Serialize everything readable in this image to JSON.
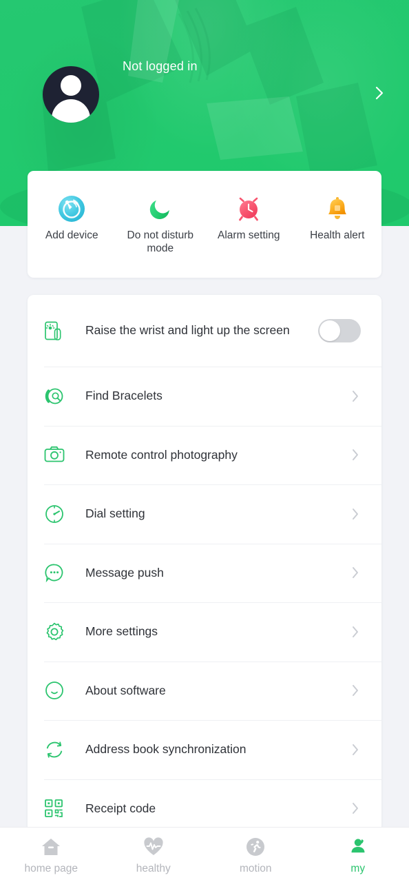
{
  "colors": {
    "brand_green": "#22c96e",
    "accent_green": "#2bc46e",
    "page_bg": "#f2f3f7",
    "card_bg": "#ffffff",
    "text_primary": "#2f3238",
    "text_muted": "#b3b5bb",
    "avatar_bg": "#1e2233",
    "toggle_off": "#d3d5d9",
    "add_device_icon": "#3fc6dd",
    "dnd_icon": "#22c96e",
    "alarm_icon": "#f8556f",
    "health_alert_icon": "#fcb024"
  },
  "header": {
    "login_status": "Not logged in",
    "chevron_icon": "chevron-right-icon",
    "avatar_icon": "default-avatar-icon"
  },
  "quick_actions": [
    {
      "label": "Add device",
      "icon": "add-device-icon"
    },
    {
      "label": "Do not disturb mode",
      "icon": "moon-icon"
    },
    {
      "label": "Alarm setting",
      "icon": "alarm-clock-icon"
    },
    {
      "label": "Health alert",
      "icon": "bell-icon"
    }
  ],
  "settings_rows": [
    {
      "label": "Raise the wrist and light up the screen",
      "icon": "wrist-raise-screen-icon",
      "control": "toggle",
      "toggle_on": false
    },
    {
      "label": "Find Bracelets",
      "icon": "find-bracelet-icon",
      "control": "chevron"
    },
    {
      "label": "Remote control photography",
      "icon": "camera-icon",
      "control": "chevron"
    },
    {
      "label": "Dial setting",
      "icon": "watch-dial-icon",
      "control": "chevron"
    },
    {
      "label": "Message push",
      "icon": "message-bubble-icon",
      "control": "chevron"
    },
    {
      "label": "More settings",
      "icon": "gear-icon",
      "control": "chevron"
    },
    {
      "label": "About software",
      "icon": "smiley-face-icon",
      "control": "chevron"
    },
    {
      "label": "Address book synchronization",
      "icon": "sync-refresh-icon",
      "control": "chevron"
    },
    {
      "label": "Receipt code",
      "icon": "qr-code-icon",
      "control": "chevron"
    }
  ],
  "bottom_nav": {
    "active_index": 3,
    "items": [
      {
        "label": "home page",
        "icon": "home-icon"
      },
      {
        "label": "healthy",
        "icon": "heart-pulse-icon"
      },
      {
        "label": "motion",
        "icon": "running-person-icon"
      },
      {
        "label": "my",
        "icon": "person-icon"
      }
    ]
  }
}
